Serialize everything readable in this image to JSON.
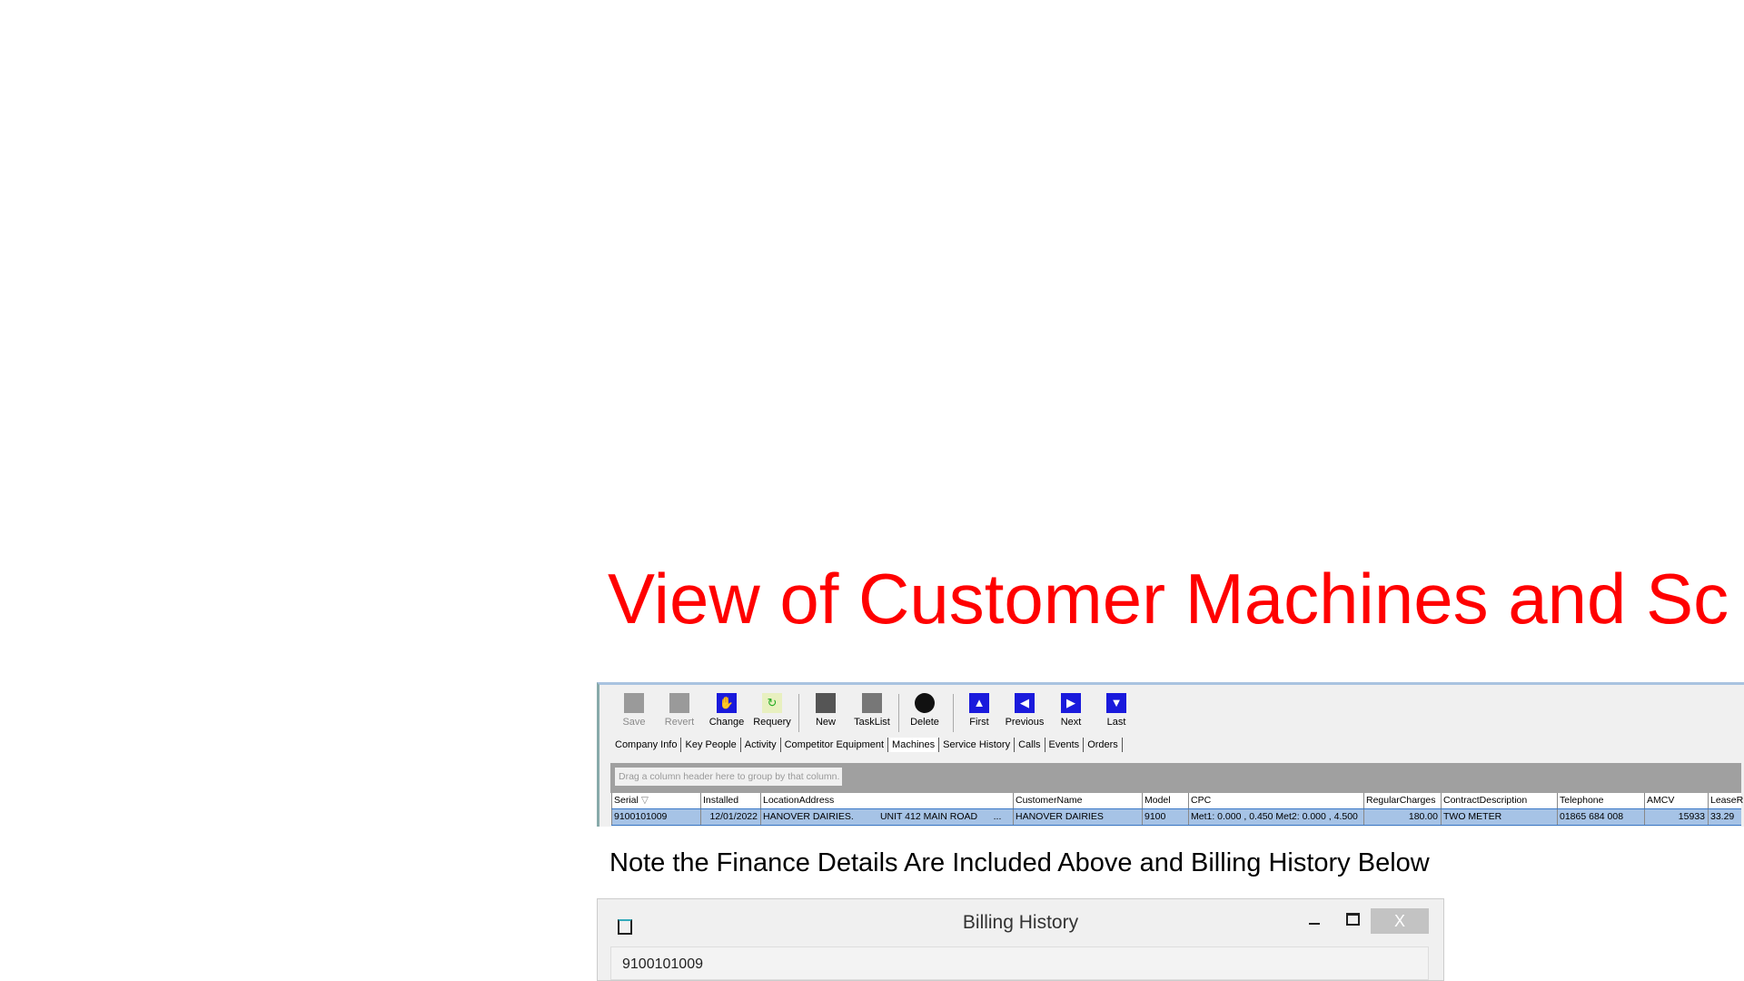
{
  "slide": {
    "title": "View of Customer Machines and Sc",
    "note": "Note the Finance Details Are Included Above and Billing History Below",
    "title_color": "#ff0000"
  },
  "toolbar": [
    {
      "label": "Save",
      "icon": "save-icon",
      "enabled": false
    },
    {
      "label": "Revert",
      "icon": "revert-icon",
      "enabled": false
    },
    {
      "label": "Change",
      "icon": "hand-icon",
      "enabled": true
    },
    {
      "label": "Requery",
      "icon": "refresh-icon",
      "enabled": true
    },
    {
      "label": "New",
      "icon": "new-icon",
      "enabled": true
    },
    {
      "label": "TaskList",
      "icon": "tasklist-icon",
      "enabled": true
    },
    {
      "label": "Delete",
      "icon": "delete-icon",
      "enabled": true
    },
    {
      "label": "First",
      "icon": "first-icon",
      "enabled": true
    },
    {
      "label": "Previous",
      "icon": "previous-icon",
      "enabled": true
    },
    {
      "label": "Next",
      "icon": "next-icon",
      "enabled": true
    },
    {
      "label": "Last",
      "icon": "last-icon",
      "enabled": true
    }
  ],
  "tabs": [
    "Company Info",
    "Key People",
    "Activity",
    "Competitor Equipment",
    "Machines",
    "Service History",
    "Calls",
    "Events",
    "Orders"
  ],
  "active_tab": "Machines",
  "grid": {
    "group_hint": "Drag a column header here to group by that column.",
    "columns": [
      "Serial",
      "Installed",
      "LocationAddress",
      "CustomerName",
      "Model",
      "CPC",
      "RegularCharges",
      "ContractDescription",
      "Telephone",
      "AMCV",
      "LeaseR"
    ],
    "sort_indicator": "▽",
    "rows": [
      [
        "9100101009",
        "12/01/2022",
        "HANOVER DAIRIES.          UNIT 412 MAIN ROAD      ...",
        "HANOVER DAIRIES",
        "9100",
        "Met1: 0.000 , 0.450 Met2: 0.000 , 4.500",
        "180.00",
        "TWO METER",
        "01865 684 008",
        "15933",
        "33.29"
      ]
    ]
  },
  "billing": {
    "title": "Billing History",
    "close": "X",
    "serial": "9100101009"
  }
}
